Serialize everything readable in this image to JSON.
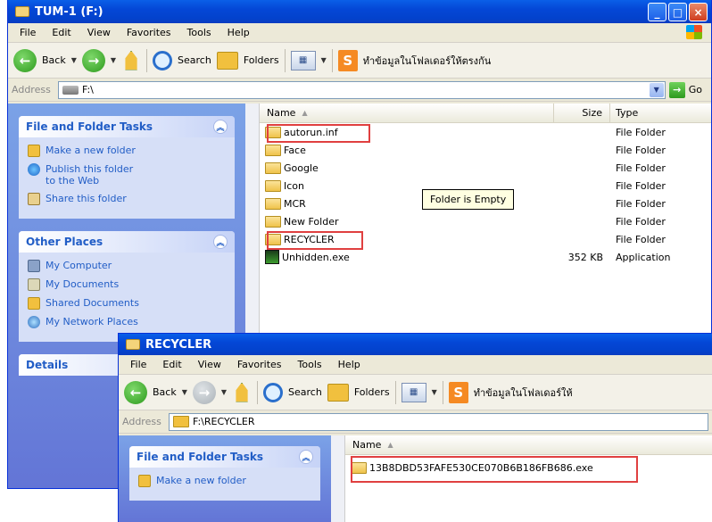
{
  "window1": {
    "title": "TUM-1 (F:)",
    "menu": [
      "File",
      "Edit",
      "View",
      "Favorites",
      "Tools",
      "Help"
    ],
    "toolbar": {
      "back": "Back",
      "search": "Search",
      "folders": "Folders",
      "thai_label": "ทำข้อมูลในโฟลเดอร์ให้ตรงกัน"
    },
    "address_label": "Address",
    "address_value": "F:\\",
    "go_label": "Go",
    "tasks_title": "File and Folder Tasks",
    "tasks": [
      "Make a new folder",
      "Publish this folder to the Web",
      "Share this folder"
    ],
    "other_places_title": "Other Places",
    "other_places": [
      "My Computer",
      "My Documents",
      "Shared Documents",
      "My Network Places"
    ],
    "details_title": "Details",
    "columns": {
      "name": "Name",
      "size": "Size",
      "type": "Type"
    },
    "files": [
      {
        "name": "autorun.inf",
        "size": "",
        "type": "File Folder",
        "icon": "folder"
      },
      {
        "name": "Face",
        "size": "",
        "type": "File Folder",
        "icon": "folder"
      },
      {
        "name": "Google",
        "size": "",
        "type": "File Folder",
        "icon": "folder"
      },
      {
        "name": "Icon",
        "size": "",
        "type": "File Folder",
        "icon": "folder"
      },
      {
        "name": "MCR",
        "size": "",
        "type": "File Folder",
        "icon": "folder"
      },
      {
        "name": "New Folder",
        "size": "",
        "type": "File Folder",
        "icon": "folder"
      },
      {
        "name": "RECYCLER",
        "size": "",
        "type": "File Folder",
        "icon": "folder"
      },
      {
        "name": "Unhidden.exe",
        "size": "352 KB",
        "type": "Application",
        "icon": "exe"
      }
    ],
    "tooltip": "Folder is Empty"
  },
  "window2": {
    "title": "RECYCLER",
    "menu": [
      "File",
      "Edit",
      "View",
      "Favorites",
      "Tools",
      "Help"
    ],
    "toolbar": {
      "back": "Back",
      "search": "Search",
      "folders": "Folders",
      "thai_label": "ทำข้อมูลในโฟลเดอร์ให้"
    },
    "address_label": "Address",
    "address_value": "F:\\RECYCLER",
    "tasks_title": "File and Folder Tasks",
    "tasks": [
      "Make a new folder"
    ],
    "columns": {
      "name": "Name"
    },
    "files": [
      {
        "name": "13B8DBD53FAFE530CE070B6B186FB686.exe",
        "icon": "folder"
      }
    ]
  },
  "colors": {
    "titlebar": "#0447d6",
    "highlight_box": "#e04040",
    "task_link": "#215dc6"
  }
}
